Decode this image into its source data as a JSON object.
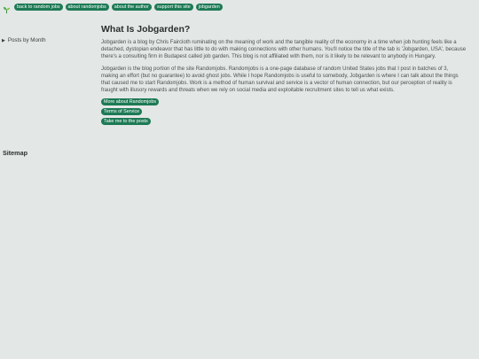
{
  "nav": {
    "logo_icon": "sprout-icon",
    "items": [
      {
        "label": "back to random jobs"
      },
      {
        "label": "about randomjobs"
      },
      {
        "label": "about the author"
      },
      {
        "label": "support this site"
      },
      {
        "label": "jobgarden"
      }
    ]
  },
  "sidebar": {
    "toggle_icon": "triangle-right-icon",
    "label": "Posts by Month"
  },
  "main": {
    "title": "What Is Jobgarden?",
    "paragraphs": [
      "Jobgarden is a blog by Chris Faircloth ruminating on the meaning of work and the tangible reality of the economy in a time when job hunting feels like a detached, dystopian endeavor that has little to do with making connections with other humans. You'll notice the title of the tab is 'Jobgarden, USA', because there's a consulting firm in Budapest called job garden. This blog is not affiliated with them, nor is it likely to be relevant to anybody in Hungary.",
      "Jobgarden is the blog portion of the site Randomjobs. Randomjobs is a one-page database of random United States jobs that I post in batches of 3, making an effort (but no guarantee) to avoid ghost jobs. While I hope Randomjobs is useful to somebody, Jobgarden is where I can talk about the things that caused me to start Randomjobs. Work is a method of human survival and service is a vector of human connection, but our perception of reality is fraught with illusory rewards and threats when we rely on social media and exploitable recruitment sites to tell us what exists."
    ],
    "buttons": [
      {
        "label": "More about Randomjobs"
      },
      {
        "label": "Terms of Service"
      },
      {
        "label": "Take me to the posts"
      }
    ]
  },
  "footer": {
    "sitemap_label": "Sitemap"
  },
  "colors": {
    "background": "#e3e7e6",
    "accent": "#1d7a55"
  }
}
